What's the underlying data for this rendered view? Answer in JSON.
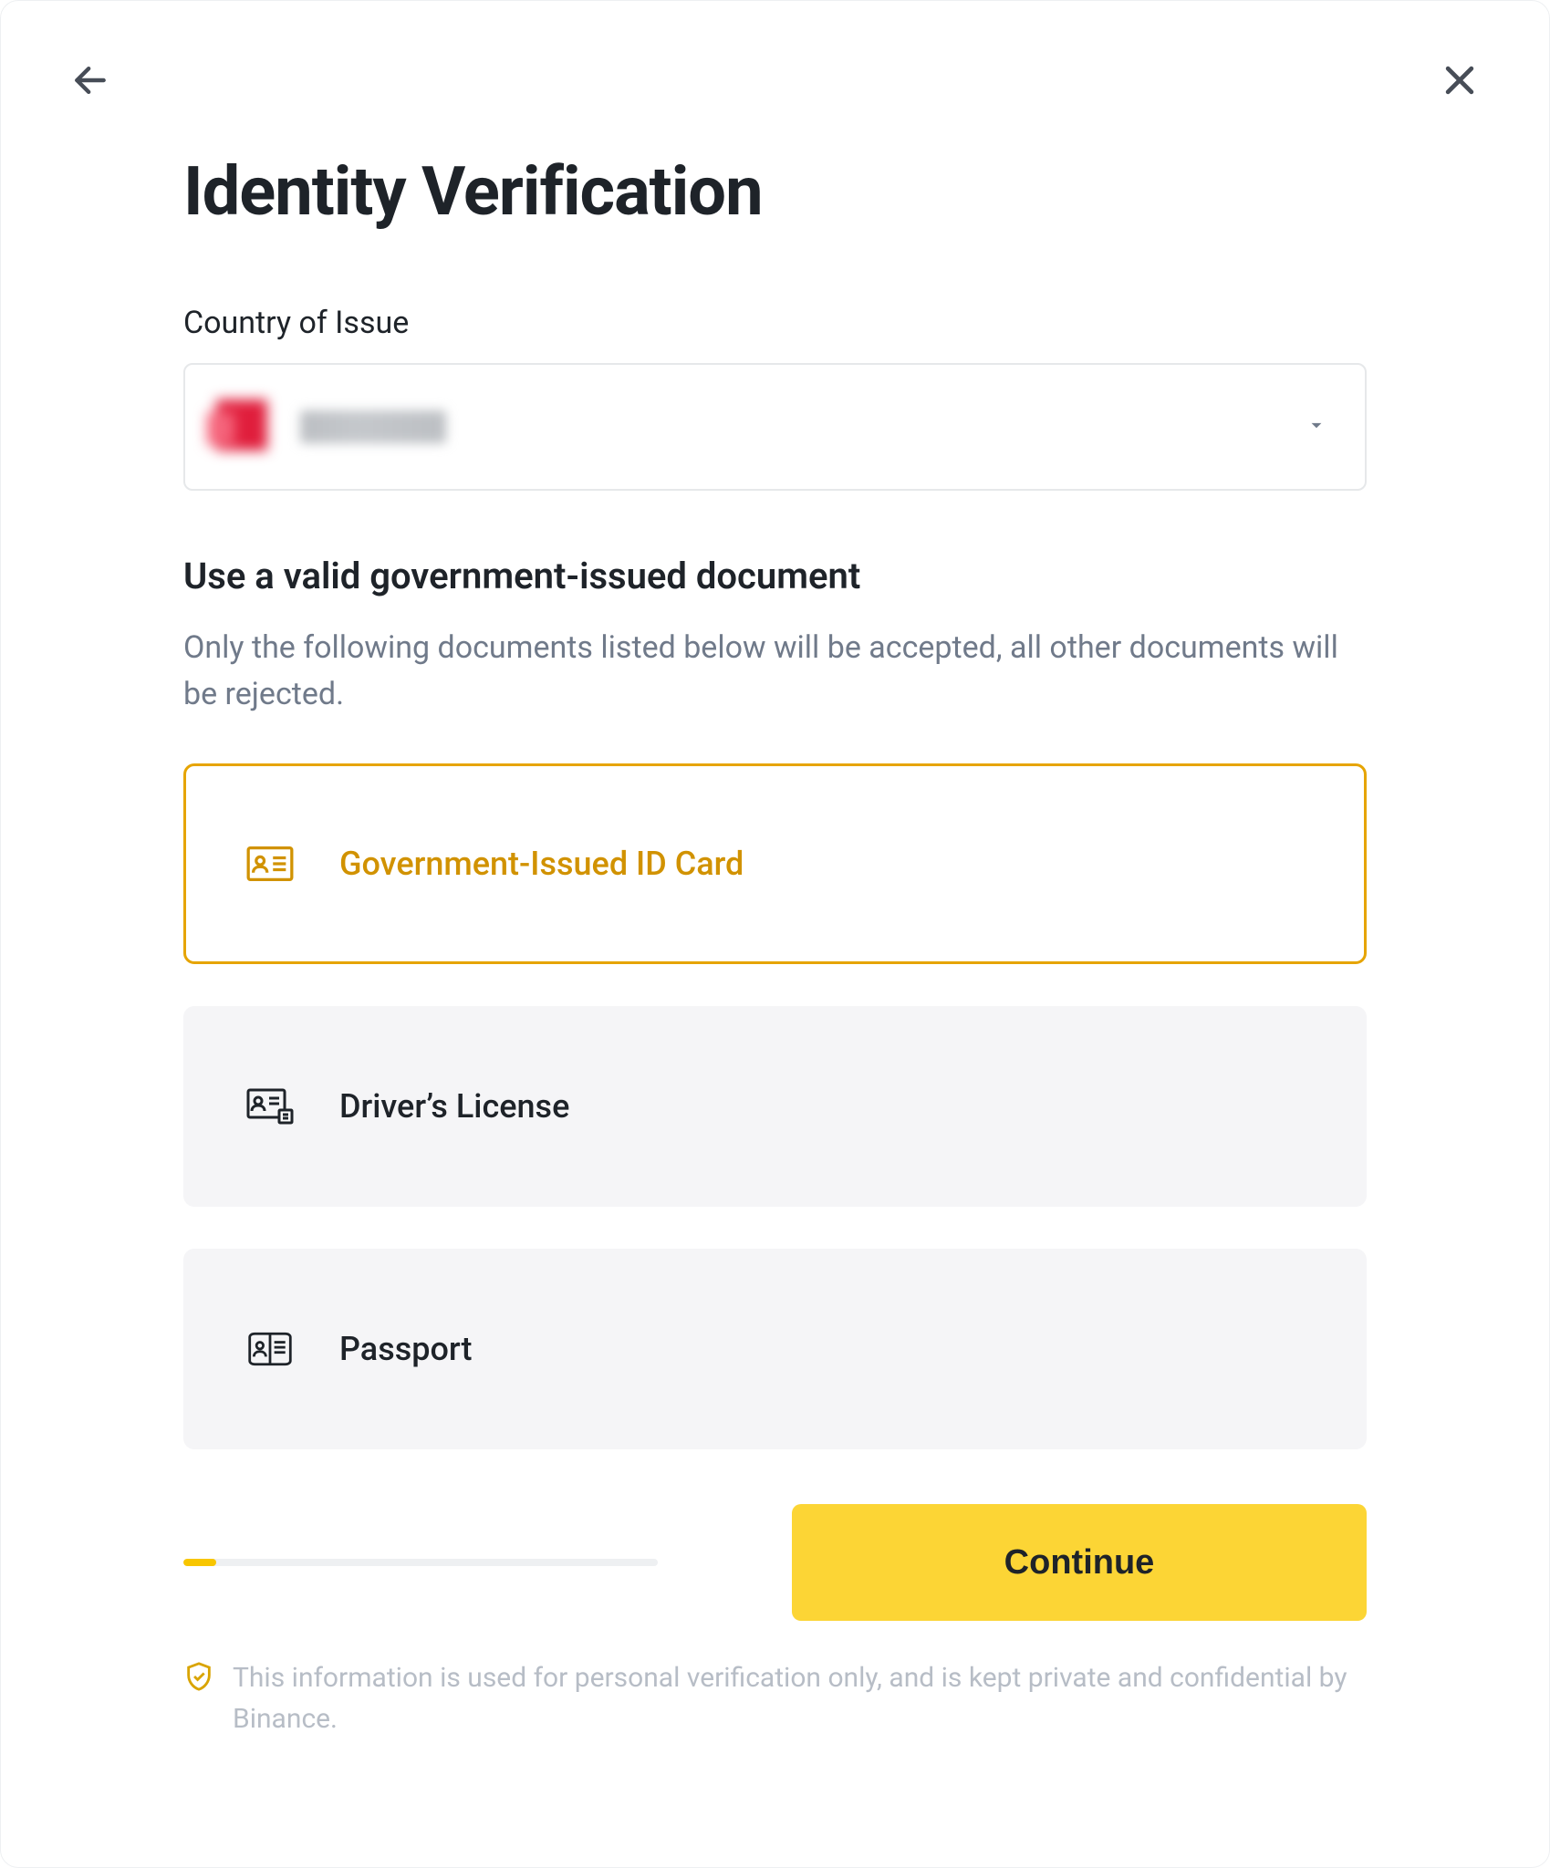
{
  "header": {
    "title": "Identity Verification"
  },
  "country": {
    "label": "Country of Issue",
    "selected_display": "[redacted]"
  },
  "document_section": {
    "title": "Use a valid government-issued document",
    "subtitle": "Only the following documents listed below will be accepted, all other documents will be rejected."
  },
  "documents": [
    {
      "id": "gov-id",
      "label": "Government-Issued ID Card",
      "icon": "id-card-icon",
      "selected": true
    },
    {
      "id": "license",
      "label": "Driver’s License",
      "icon": "drivers-license-icon",
      "selected": false
    },
    {
      "id": "passport",
      "label": "Passport",
      "icon": "passport-icon",
      "selected": false
    }
  ],
  "progress": {
    "percent": 7
  },
  "actions": {
    "continue_label": "Continue"
  },
  "disclaimer": {
    "text": "This information is used for personal verification only, and is kept private and confidential by Binance."
  },
  "colors": {
    "accent": "#fcd535",
    "accent_dark": "#d19200",
    "text": "#1e2329",
    "muted": "#707a8a"
  }
}
